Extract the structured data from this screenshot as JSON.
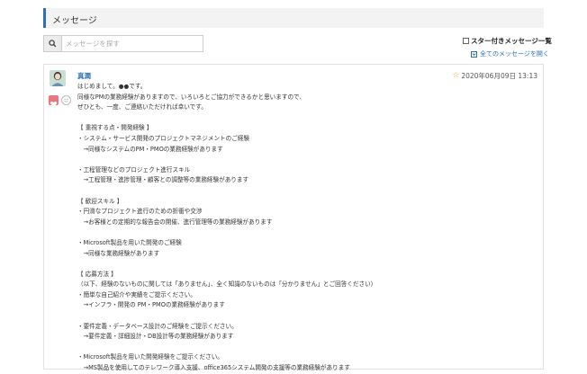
{
  "header": {
    "title": "メッセージ"
  },
  "search": {
    "placeholder": "メッセージを探す",
    "icon": "search-icon"
  },
  "filter": {
    "starred_label": "スター付きメッセージ一覧",
    "open_all_label": "全てのメッセージを開く"
  },
  "message": {
    "sender": "真潤",
    "timestamp": "2020年06月09日 13:13",
    "colors": {
      "accent": "#2f6fb5",
      "like": "#e9757f",
      "star": "#f0a020"
    },
    "lines": [
      "はじめまして。●●です。",
      "同様なPMの業務経験がありますので、いろいろとご協力ができるかと思いますので、",
      "ぜひとも、一度、ご連絡いただければ幸いです。",
      "",
      "【 重視する点・開発経験 】",
      "・システム・サービス開発のプロジェクトマネジメントのご経験",
      "　→同様なシステムのPM・PMOの業務経験があります",
      "",
      "・工程管理などのプロジェクト進行スキル",
      "　→工程管理・進捗管理・顧客との調整等の業務経験があります",
      "",
      "【 歓迎スキル 】",
      "・円滑なプロジェクト進行のための折衝や交渉",
      "　→お客様との定期的な報告会の開催、進行管理等の業務経験があります",
      "",
      "・Microsoft製品を用いた開発のご経験",
      "　→同様な業務経験があります",
      "",
      "【 応募方法 】",
      "（以下、経験のないものに関しては「ありません」、全く知識のないものは「分かりません」とご回答ください）",
      "・簡単な自己紹介や実績をご提示ください。",
      "　→インフラ・開発の PM・PMOの業務経験があります",
      "",
      "・要件定義・データベース設計のご経験をご提示ください。",
      "　→要件定義・詳細設計・DB設計等の業務経験があります",
      "",
      "・Microsoft製品を用いた開発経験をご提示ください。",
      "　→MS製品を使用してのテレワーク導入支援、office365システム開発の支援等の業務経験があります"
    ]
  }
}
